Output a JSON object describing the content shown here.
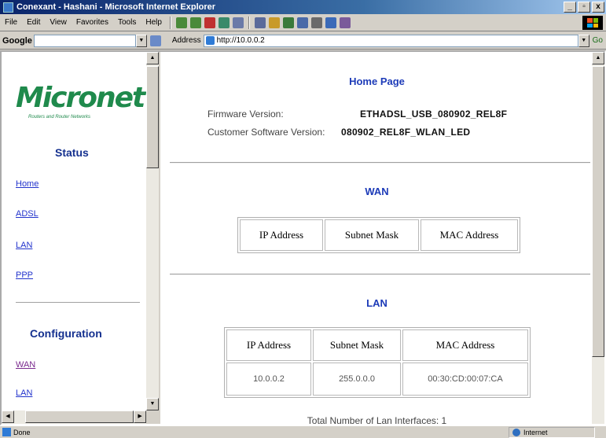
{
  "window": {
    "title": "Conexant - Hashani - Microsoft Internet Explorer",
    "controls": [
      "_",
      "▫",
      "x"
    ]
  },
  "menu": [
    "File",
    "Edit",
    "View",
    "Favorites",
    "Tools",
    "Help"
  ],
  "google_bar": {
    "label": "Google"
  },
  "address_bar": {
    "label": "Address",
    "url": "http://10.0.0.2",
    "go": "Go"
  },
  "sidebar": {
    "logo_text": "Micronet",
    "logo_tagline": "Routers and Router Networks",
    "status_heading": "Status",
    "status_links": [
      {
        "label": "Home"
      },
      {
        "label": "ADSL"
      },
      {
        "label": "LAN"
      },
      {
        "label": "PPP"
      }
    ],
    "config_heading": "Configuration",
    "config_links": [
      {
        "label": "WAN"
      },
      {
        "label": "LAN"
      }
    ]
  },
  "main": {
    "title": "Home Page",
    "firmware_label": "Firmware Version:",
    "firmware_value": "ETHADSL_USB_080902_REL8F",
    "customer_label": "Customer Software Version:",
    "customer_value": "080902_REL8F_WLAN_LED",
    "wan": {
      "heading": "WAN",
      "columns": [
        "IP Address",
        "Subnet Mask",
        "MAC Address"
      ]
    },
    "lan": {
      "heading": "LAN",
      "columns": [
        "IP Address",
        "Subnet Mask",
        "MAC Address"
      ],
      "rows": [
        [
          "10.0.0.2",
          "255.0.0.0",
          "00:30:CD:00:07:CA"
        ]
      ]
    },
    "total_text": "Total Number of Lan Interfaces: 1"
  },
  "status_bar": {
    "text": "Done",
    "zone": "Internet"
  }
}
